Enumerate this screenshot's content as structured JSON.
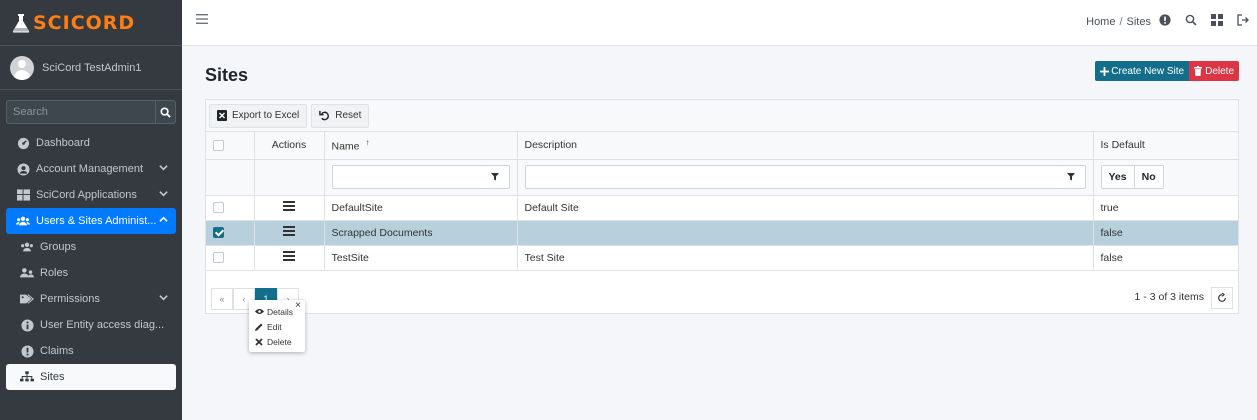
{
  "brand": {
    "logo_text": "SCICORD",
    "accent": "#fd7e14"
  },
  "user": {
    "name": "SciCord TestAdmin1"
  },
  "search": {
    "placeholder": "Search"
  },
  "sidebar": {
    "items": [
      {
        "label": "Dashboard",
        "icon": "dashboard-icon"
      },
      {
        "label": "Account Management",
        "icon": "account-icon"
      },
      {
        "label": "SciCord Applications",
        "icon": "apps-icon"
      },
      {
        "label": "Users & Sites Administ...",
        "icon": "users-icon"
      },
      {
        "label": "Groups",
        "icon": "groups-icon"
      },
      {
        "label": "Roles",
        "icon": "roles-icon"
      },
      {
        "label": "Permissions",
        "icon": "tag-icon"
      },
      {
        "label": "User Entity access diag...",
        "icon": "info-icon"
      },
      {
        "label": "Claims",
        "icon": "info-icon"
      },
      {
        "label": "Sites",
        "icon": "sitemap-icon"
      }
    ]
  },
  "breadcrumb": {
    "home": "Home",
    "sep": "/",
    "current": "Sites"
  },
  "page": {
    "title": "Sites",
    "create_label": "Create New Site",
    "delete_label": "Delete"
  },
  "toolbar": {
    "export_label": "Export to Excel",
    "reset_label": "Reset"
  },
  "table": {
    "columns": [
      "Actions",
      "Name",
      "Description",
      "Is Default"
    ],
    "sort_indicator": "↑",
    "filter": {
      "yes": "Yes",
      "no": "No"
    },
    "rows": [
      {
        "name": "DefaultSite",
        "description": "Default Site",
        "is_default": "true",
        "selected": false
      },
      {
        "name": "Scrapped Documents",
        "description": "",
        "is_default": "false",
        "selected": true
      },
      {
        "name": "TestSite",
        "description": "Test Site",
        "is_default": "false",
        "selected": false
      }
    ]
  },
  "context_menu": {
    "details": "Details",
    "edit": "Edit",
    "delete": "Delete"
  },
  "pager": {
    "info": "1 - 3 of 3 items",
    "current_page": "1"
  },
  "colors": {
    "primary": "#136e8c",
    "danger": "#dc3545",
    "active_nav": "#007bff",
    "selected_row": "#b8d0dc"
  }
}
